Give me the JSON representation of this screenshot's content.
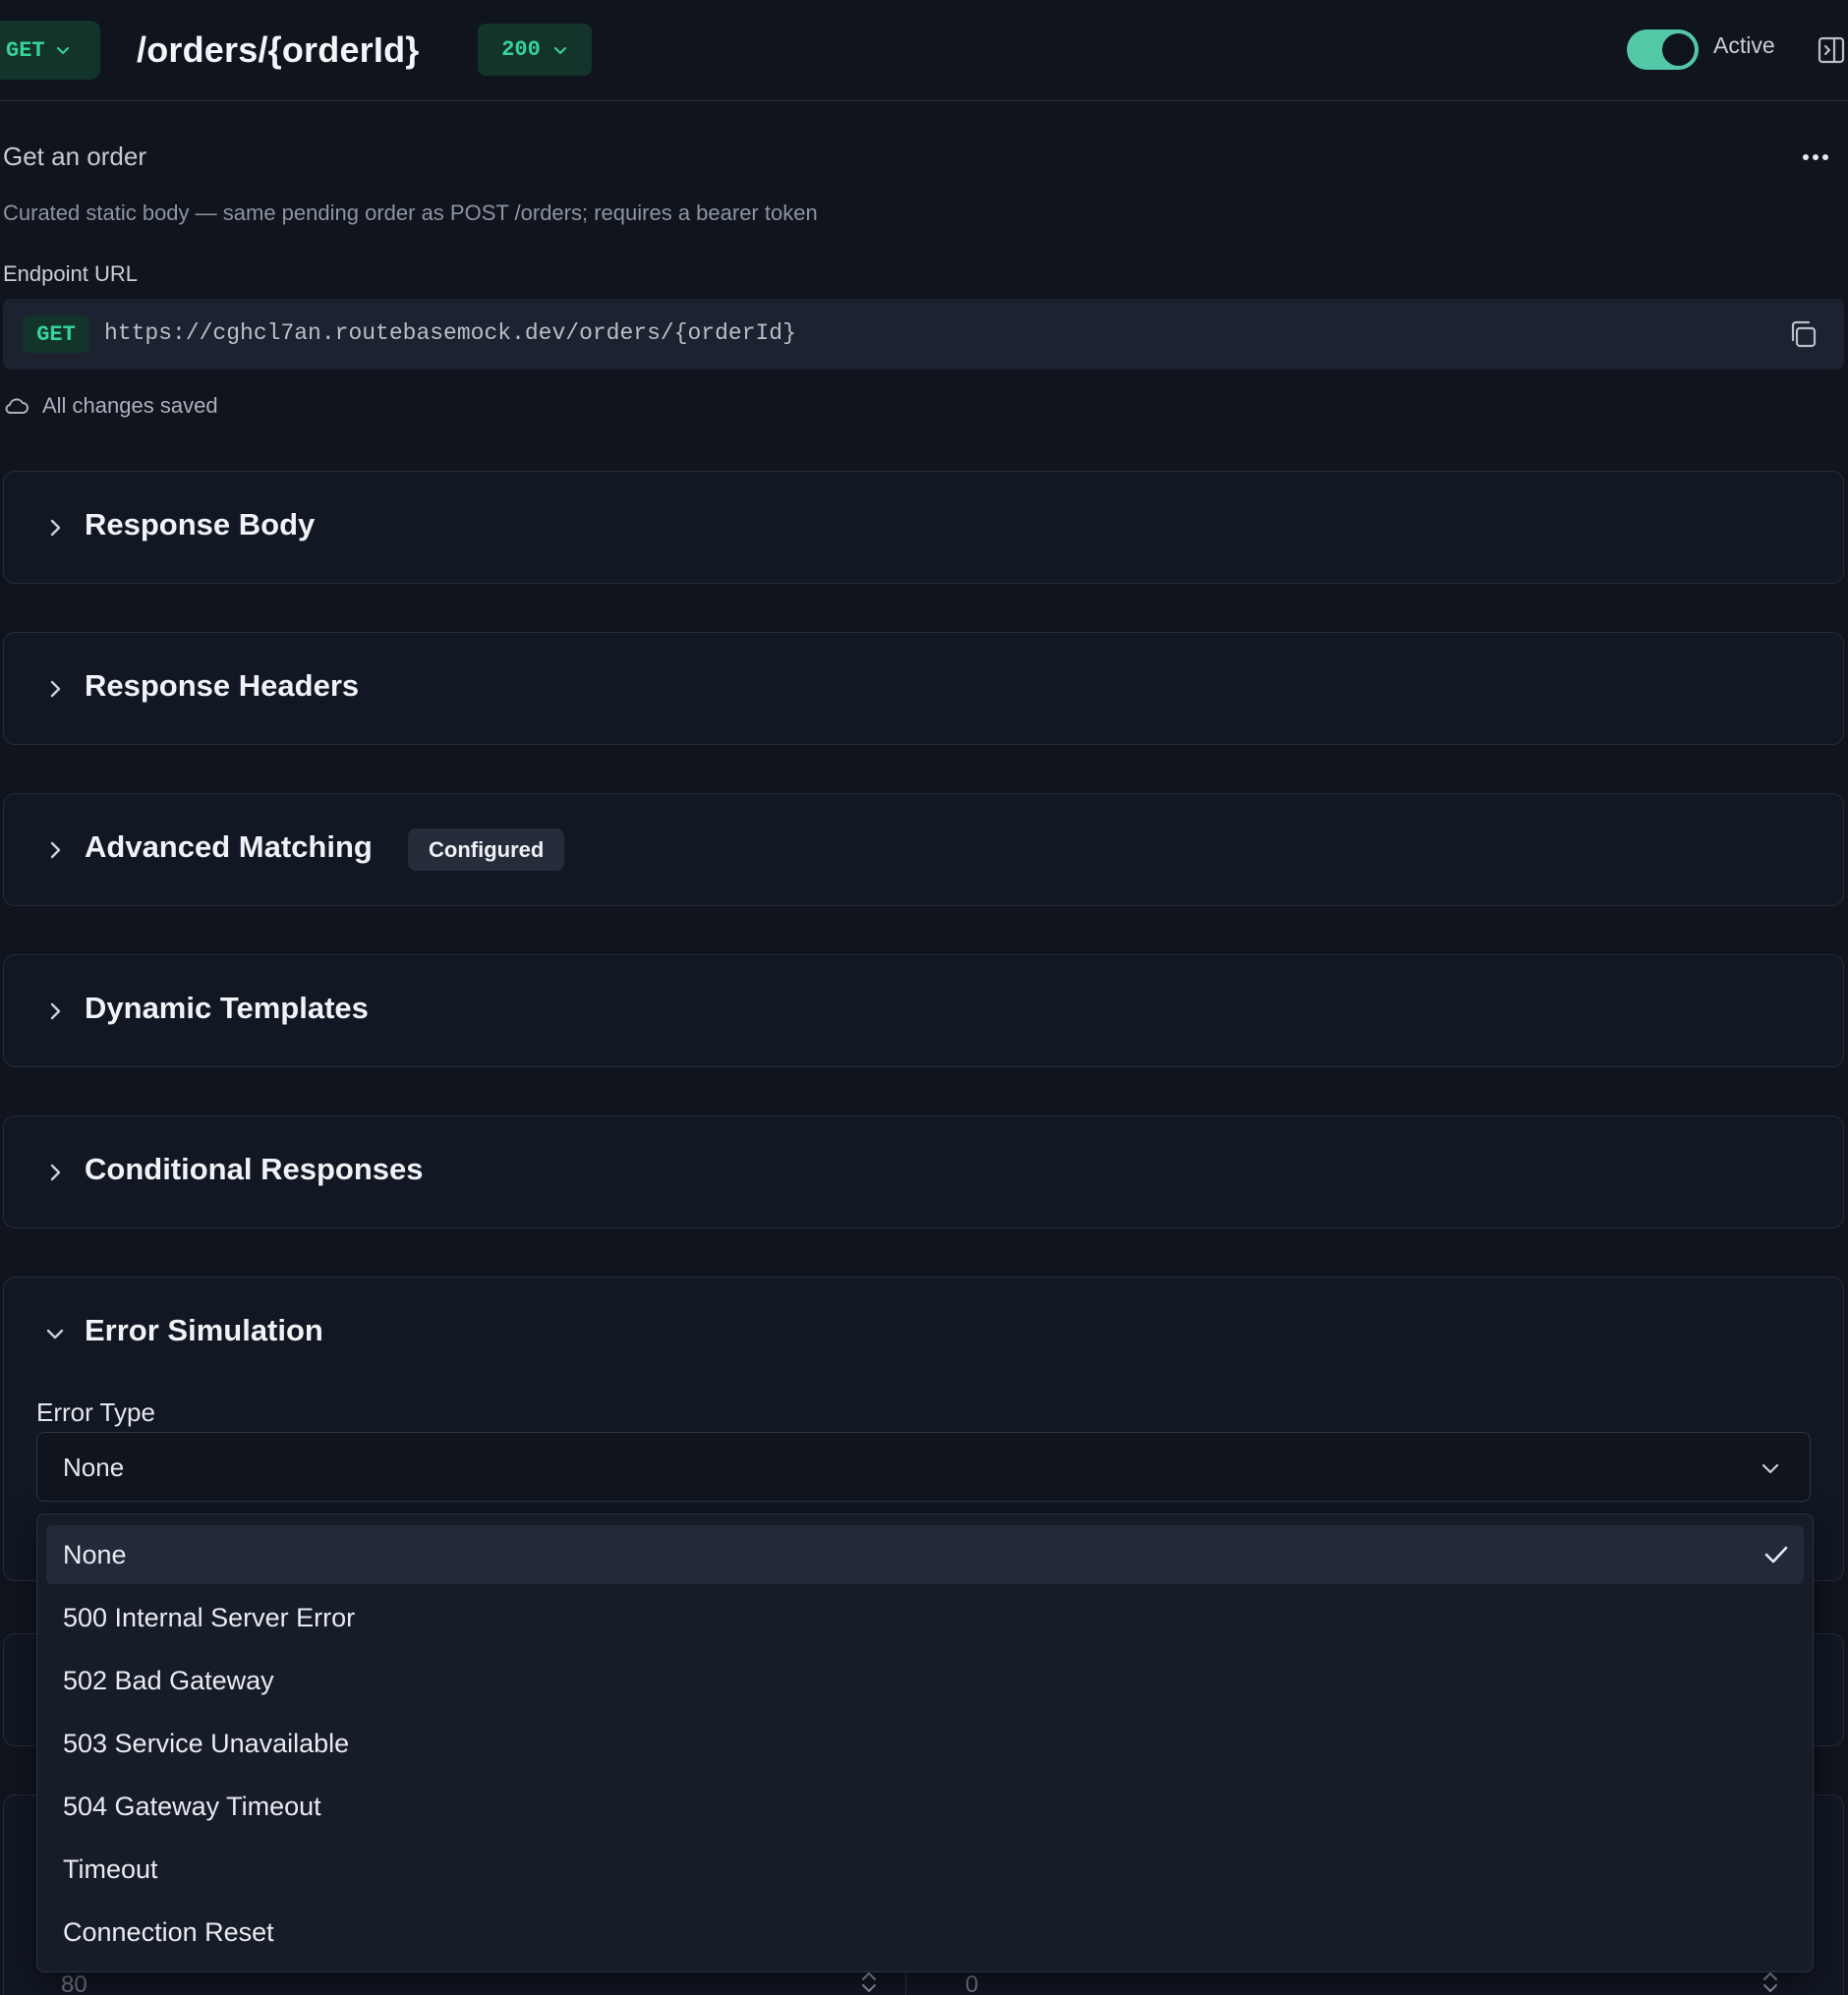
{
  "header": {
    "method": "GET",
    "path": "/orders/{orderId}",
    "status": "200",
    "active_label": "Active",
    "active": true
  },
  "summary": {
    "title": "Get an order",
    "description": "Curated static body — same pending order as POST /orders; requires a bearer token",
    "endpoint_label": "Endpoint URL",
    "url_method": "GET",
    "url": "https://cghcl7an.routebasemock.dev/orders/{orderId}",
    "save_status": "All changes saved"
  },
  "sections": [
    {
      "title": "Response Body",
      "expanded": false
    },
    {
      "title": "Response Headers",
      "expanded": false
    },
    {
      "title": "Advanced Matching",
      "expanded": false,
      "badge": "Configured"
    },
    {
      "title": "Dynamic Templates",
      "expanded": false
    },
    {
      "title": "Conditional Responses",
      "expanded": false
    },
    {
      "title": "Error Simulation",
      "expanded": true
    }
  ],
  "error_simulation": {
    "field_label": "Error Type",
    "selected": "None",
    "options": [
      "None",
      "500 Internal Server Error",
      "502 Bad Gateway",
      "503 Service Unavailable",
      "504 Gateway Timeout",
      "Timeout",
      "Connection Reset"
    ]
  },
  "peek_inputs": {
    "left_value": "80",
    "right_value": "0"
  },
  "colors": {
    "background": "#10141d",
    "accent_green": "#37d49a",
    "toggle_on": "#53c8a6"
  }
}
